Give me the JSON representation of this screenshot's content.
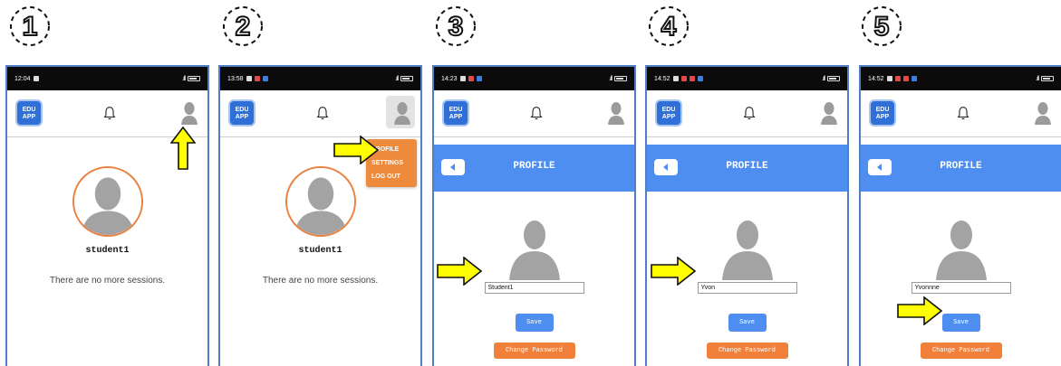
{
  "steps": [
    "1",
    "2",
    "3",
    "4",
    "5"
  ],
  "panels": [
    {
      "time": "12:04",
      "username": "student1",
      "empty_message": "There are no more sessions."
    },
    {
      "time": "13:58",
      "username": "student1",
      "empty_message": "There are no more sessions.",
      "menu": [
        "PROFILE",
        "SETTINGS",
        "LOG OUT"
      ]
    },
    {
      "time": "14:23",
      "title": "PROFILE",
      "name_value": "Student1",
      "save_label": "Save",
      "change_password_label": "Change Password"
    },
    {
      "time": "14:52",
      "title": "PROFILE",
      "name_value": "Yvon",
      "save_label": "Save",
      "change_password_label": "Change Password"
    },
    {
      "time": "14:52",
      "title": "PROFILE",
      "name_value": "Yvonnne",
      "save_label": "Save",
      "change_password_label": "Change Password"
    }
  ],
  "app": {
    "logo_line1": "EDU",
    "logo_line2": "APP"
  },
  "icons": {
    "bell": "bell-icon",
    "user": "user-icon",
    "back": "back-arrow-icon",
    "pointer": "yellow-arrow-icon"
  },
  "colors": {
    "frame": "#4f7fc2",
    "accent_blue": "#4d8ef0",
    "accent_orange": "#f0803a",
    "arrow": "#ffff00"
  }
}
